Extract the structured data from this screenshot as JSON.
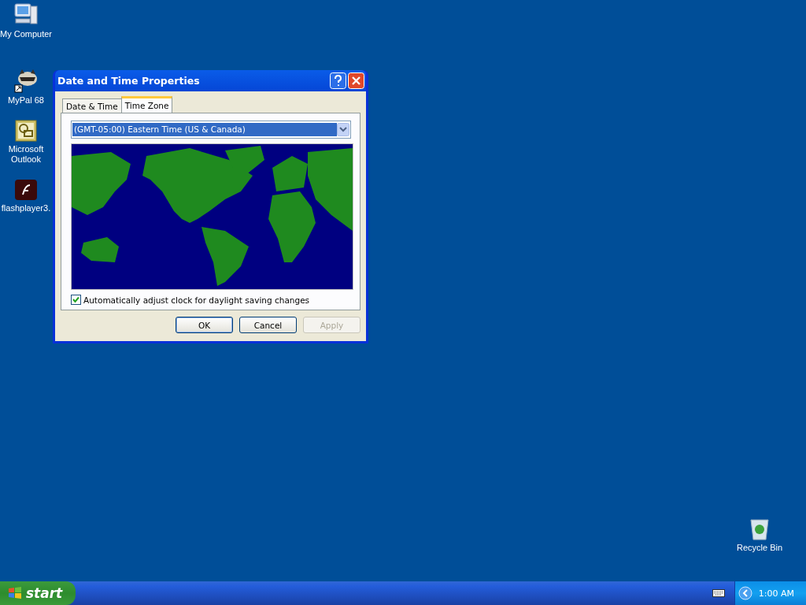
{
  "desktop_icons": [
    {
      "label": "My Computer",
      "kind": "computer"
    },
    {
      "label": "MyPal 68",
      "kind": "raccoon"
    },
    {
      "label": "Microsoft Outlook",
      "kind": "outlook"
    },
    {
      "label": "flashplayer3.",
      "kind": "flash"
    }
  ],
  "recycle_bin": {
    "label": "Recycle Bin"
  },
  "dialog": {
    "title": "Date and Time Properties",
    "tabs": [
      {
        "label": "Date & Time",
        "selected": false
      },
      {
        "label": "Time Zone",
        "selected": true
      }
    ],
    "timezone": "(GMT-05:00) Eastern Time (US & Canada)",
    "dst_checkbox": {
      "label": "Automatically adjust clock for daylight saving changes",
      "checked": true
    },
    "buttons": [
      {
        "label": "OK",
        "disabled": false
      },
      {
        "label": "Cancel",
        "disabled": false
      },
      {
        "label": "Apply",
        "disabled": true
      }
    ]
  },
  "taskbar": {
    "start": "start",
    "clock": "1:00 AM"
  }
}
